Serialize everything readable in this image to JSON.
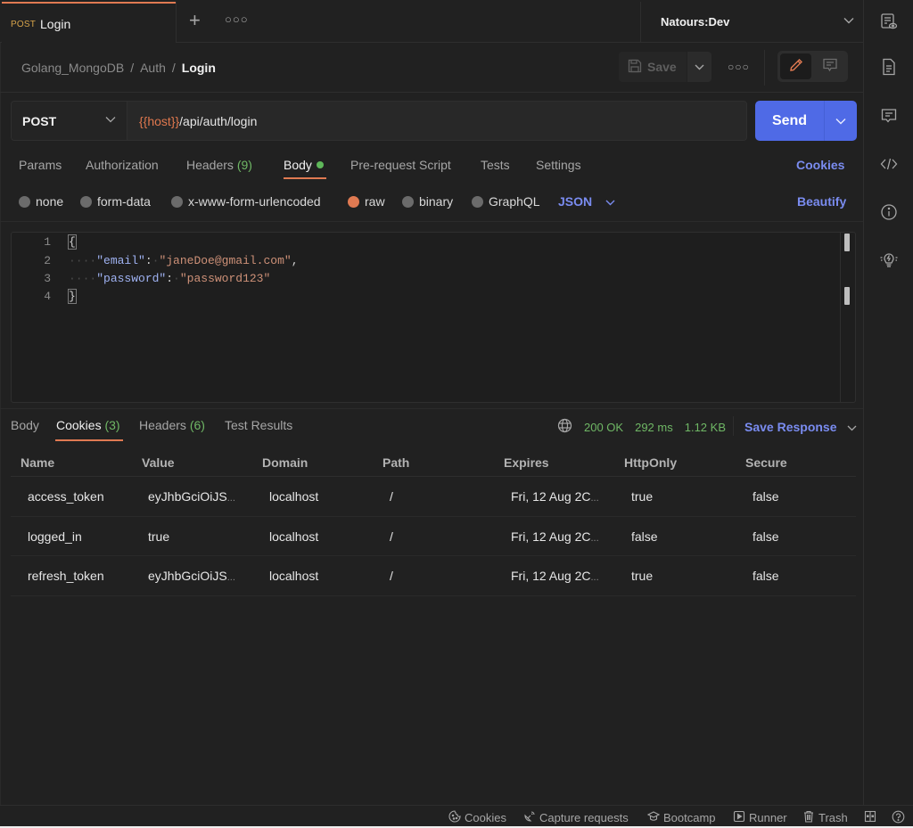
{
  "tabs": {
    "active": {
      "method": "POST",
      "name": "Login"
    },
    "add_icon": "plus-icon",
    "more_icon": "ellipsis-icon"
  },
  "environment": {
    "selected": "Natours:Dev"
  },
  "breadcrumb": {
    "items": [
      "Golang_MongoDB",
      "Auth"
    ],
    "current": "Login"
  },
  "toolbar": {
    "save_label": "Save",
    "mode_icons": [
      "pencil-icon",
      "comment-icon"
    ]
  },
  "request": {
    "method": "POST",
    "url_variable": "{{host}}",
    "url_path": "/api/auth/login",
    "send_label": "Send"
  },
  "request_tabs": [
    {
      "label": "Params"
    },
    {
      "label": "Authorization"
    },
    {
      "label": "Headers",
      "count": "(9)"
    },
    {
      "label": "Body",
      "active": true,
      "indicator": "green-dot"
    },
    {
      "label": "Pre-request Script"
    },
    {
      "label": "Tests"
    },
    {
      "label": "Settings"
    }
  ],
  "cookies_link": "Cookies",
  "body_types": [
    {
      "label": "none"
    },
    {
      "label": "form-data"
    },
    {
      "label": "x-www-form-urlencoded"
    },
    {
      "label": "raw",
      "selected": true
    },
    {
      "label": "binary"
    },
    {
      "label": "GraphQL"
    }
  ],
  "raw_language": "JSON",
  "beautify_label": "Beautify",
  "editor": {
    "lines": [
      {
        "n": "1",
        "text": "{"
      },
      {
        "n": "2",
        "key": "\"email\"",
        "value": "\"janeDoe@gmail.com\"",
        "trail": ","
      },
      {
        "n": "3",
        "key": "\"password\"",
        "value": "\"password123\"",
        "trail": ""
      },
      {
        "n": "4",
        "text": "}"
      }
    ]
  },
  "response": {
    "tabs": [
      {
        "label": "Body"
      },
      {
        "label": "Cookies",
        "count": "(3)",
        "active": true
      },
      {
        "label": "Headers",
        "count": "(6)"
      },
      {
        "label": "Test Results"
      }
    ],
    "status": "200 OK",
    "time": "292 ms",
    "size": "1.12 KB",
    "save_response_label": "Save Response"
  },
  "cookie_table": {
    "columns": [
      "Name",
      "Value",
      "Domain",
      "Path",
      "Expires",
      "HttpOnly",
      "Secure"
    ],
    "rows": [
      [
        "access_token",
        "eyJhbGciOiJS",
        "localhost",
        "/",
        "Fri, 12 Aug 2C",
        "true",
        "false"
      ],
      [
        "logged_in",
        "true",
        "localhost",
        "/",
        "Fri, 12 Aug 2C",
        "false",
        "false"
      ],
      [
        "refresh_token",
        "eyJhbGciOiJS",
        "localhost",
        "/",
        "Fri, 12 Aug 2C",
        "true",
        "false"
      ]
    ],
    "truncated_cells": [
      [
        0,
        1
      ],
      [
        0,
        4
      ],
      [
        1,
        4
      ],
      [
        2,
        1
      ],
      [
        2,
        4
      ]
    ],
    "ellipsis": "..."
  },
  "statusbar": {
    "items": [
      {
        "label": "Cookies",
        "icon": "cookie-icon"
      },
      {
        "label": "Capture requests",
        "icon": "satellite-icon"
      },
      {
        "label": "Bootcamp",
        "icon": "graduation-cap-icon"
      },
      {
        "label": "Runner",
        "icon": "play-box-icon"
      },
      {
        "label": "Trash",
        "icon": "trash-icon"
      }
    ]
  },
  "rightbar": {
    "icons": [
      "environment-quicklook-icon",
      "documentation-icon",
      "comments-icon",
      "code-icon",
      "info-icon",
      "lightbulb-icon"
    ]
  },
  "colors": {
    "accent_orange": "#e07a52",
    "send_blue": "#4f6ae6",
    "link_blue": "#7a8cf0",
    "success_green": "#6fb765",
    "background": "#212121"
  }
}
